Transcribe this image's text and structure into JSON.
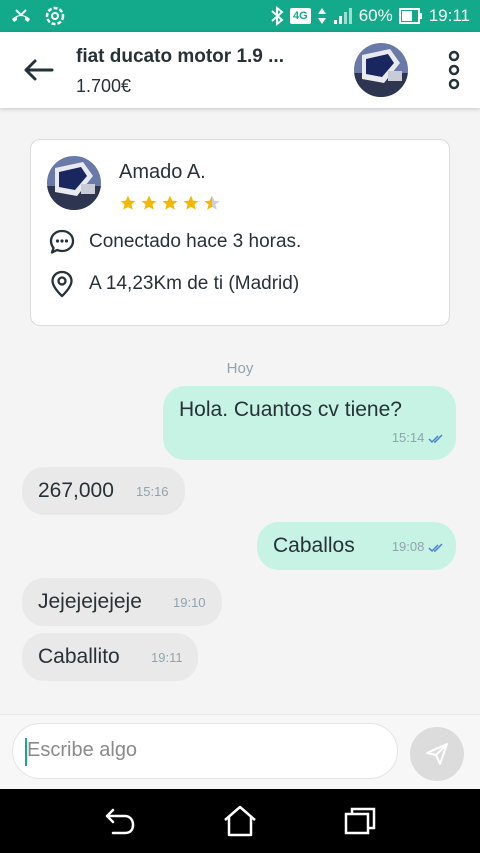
{
  "status_bar": {
    "network": "4G",
    "battery": "60%",
    "time": "19:11"
  },
  "header": {
    "title": "fiat ducato motor 1.9 ...",
    "price": "1.700€"
  },
  "seller": {
    "name": "Amado A.",
    "rating": 4.5,
    "status": "Conectado hace 3 horas.",
    "location": "A 14,23Km de ti (Madrid)"
  },
  "chat": {
    "day_label": "Hoy",
    "messages": [
      {
        "direction": "out",
        "text": "Hola. Cuantos cv tiene?",
        "time": "15:14"
      },
      {
        "direction": "in",
        "text": "267,000",
        "time": "15:16"
      },
      {
        "direction": "out",
        "text": "Caballos",
        "time": "19:08"
      },
      {
        "direction": "in",
        "text": "Jejejejejeje",
        "time": "19:10"
      },
      {
        "direction": "in",
        "text": "Caballito",
        "time": "19:11"
      }
    ]
  },
  "composer": {
    "placeholder": "Escribe algo"
  },
  "colors": {
    "brand": "#13a98b",
    "outgoing_bubble": "#c6f3e4",
    "incoming_bubble": "#e9e9e9",
    "star": "#f5b800"
  }
}
